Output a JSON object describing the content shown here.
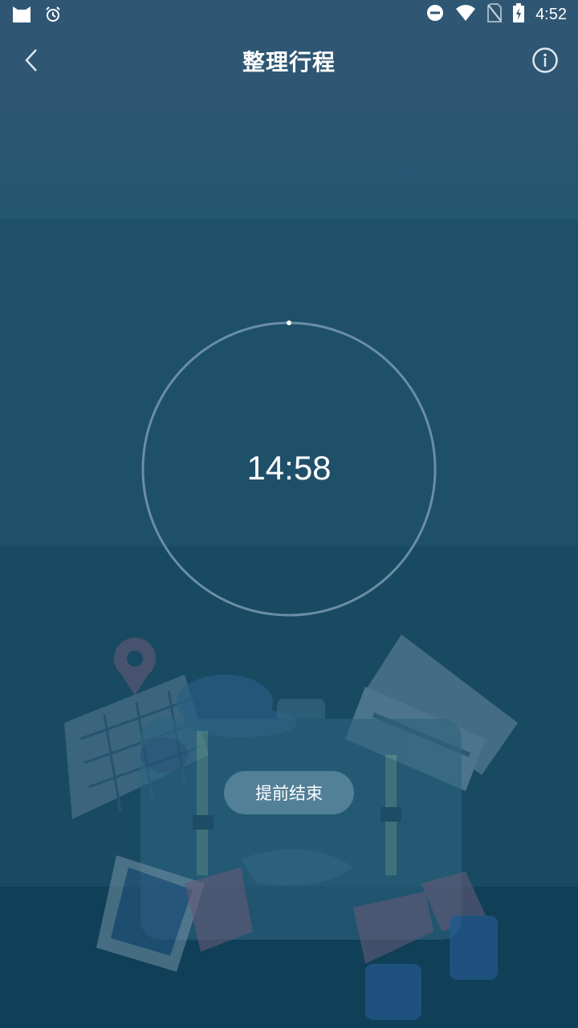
{
  "status_bar": {
    "time": "4:52",
    "icons": [
      "cat-app-icon",
      "alarm-icon",
      "do-not-disturb-icon",
      "wifi-icon",
      "no-sim-icon",
      "battery-charging-icon"
    ]
  },
  "app_bar": {
    "title": "整理行程",
    "back_icon": "chevron-left-icon",
    "info_icon": "info-circle-icon"
  },
  "timer": {
    "remaining": "14:58"
  },
  "actions": {
    "end_early_label": "提前结束"
  },
  "colors": {
    "ring": "#6a8ea6",
    "text": "#ffffff",
    "button_bg": "#7aa0b5"
  }
}
